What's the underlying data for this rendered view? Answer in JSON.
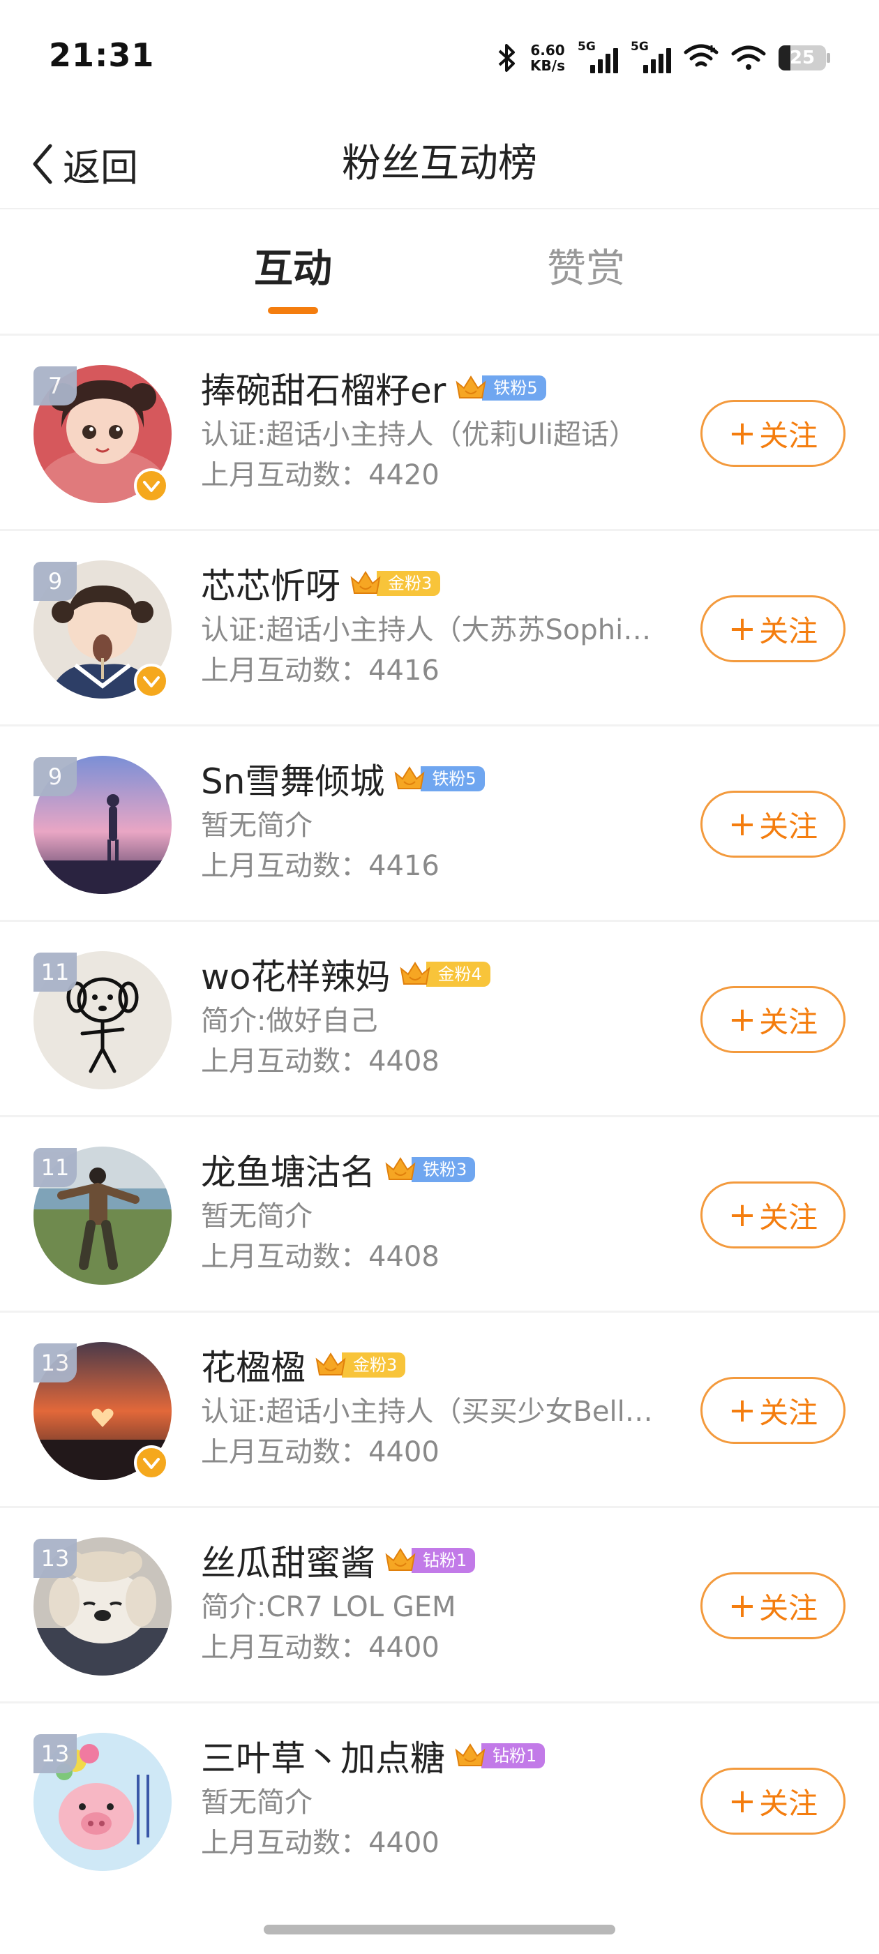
{
  "status_bar": {
    "time": "21:31",
    "net_speed_value": "6.60",
    "net_speed_unit": "KB/s",
    "signal_1_label": "5G",
    "signal_2_label": "5G",
    "battery_level": "25",
    "battery_fraction": 0.25
  },
  "nav": {
    "back_label": "返回",
    "title": "粉丝互动榜"
  },
  "tabs": [
    {
      "label": "互动",
      "active": true
    },
    {
      "label": "赞赏",
      "active": false
    }
  ],
  "accent_color": "#f47d0e",
  "follow_label": "关注",
  "fans": [
    {
      "rank": "7",
      "name": "捧碗甜石榴籽er",
      "badge_level": "铁粉5",
      "badge_tier": "iron",
      "bio": "认证:超话小主持人（优莉Uli超话）",
      "count_label": "上月互动数：",
      "count": "4420",
      "verified": true,
      "avatar_icon": "cartoon-girl-avatar"
    },
    {
      "rank": "9",
      "name": "芯芯忻呀",
      "badge_level": "金粉3",
      "badge_tier": "gold",
      "bio": "认证:超话小主持人（大苏苏Sophi…",
      "count_label": "上月互动数：",
      "count": "4416",
      "verified": true,
      "avatar_icon": "child-photo-avatar"
    },
    {
      "rank": "9",
      "name": "Sn雪舞倾城",
      "badge_level": "铁粉5",
      "badge_tier": "iron",
      "bio": "暂无简介",
      "count_label": "上月互动数：",
      "count": "4416",
      "verified": false,
      "avatar_icon": "sunset-figure-avatar"
    },
    {
      "rank": "11",
      "name": "wo花样辣妈",
      "badge_level": "金粉4",
      "badge_tier": "gold",
      "bio": "简介:做好自己",
      "count_label": "上月互动数：",
      "count": "4408",
      "verified": false,
      "avatar_icon": "doodle-dog-avatar"
    },
    {
      "rank": "11",
      "name": "龙鱼塘沽名",
      "badge_level": "铁粉3",
      "badge_tier": "iron",
      "bio": "暂无简介",
      "count_label": "上月互动数：",
      "count": "4408",
      "verified": false,
      "avatar_icon": "seaside-person-avatar"
    },
    {
      "rank": "13",
      "name": "花楹楹",
      "badge_level": "金粉3",
      "badge_tier": "gold",
      "bio": "认证:超话小主持人（买买少女Bell…",
      "count_label": "上月互动数：",
      "count": "4400",
      "verified": true,
      "avatar_icon": "sunset-heart-avatar"
    },
    {
      "rank": "13",
      "name": "丝瓜甜蜜酱",
      "badge_level": "钻粉1",
      "badge_tier": "diamond",
      "bio": "简介:CR7 LOL GEM",
      "count_label": "上月互动数：",
      "count": "4400",
      "verified": false,
      "avatar_icon": "puppy-avatar"
    },
    {
      "rank": "13",
      "name": "三叶草丶加点糖",
      "badge_level": "钻粉1",
      "badge_tier": "diamond",
      "bio": "暂无简介",
      "count_label": "上月互动数：",
      "count": "4400",
      "verified": false,
      "avatar_icon": "pig-cartoon-avatar"
    }
  ]
}
